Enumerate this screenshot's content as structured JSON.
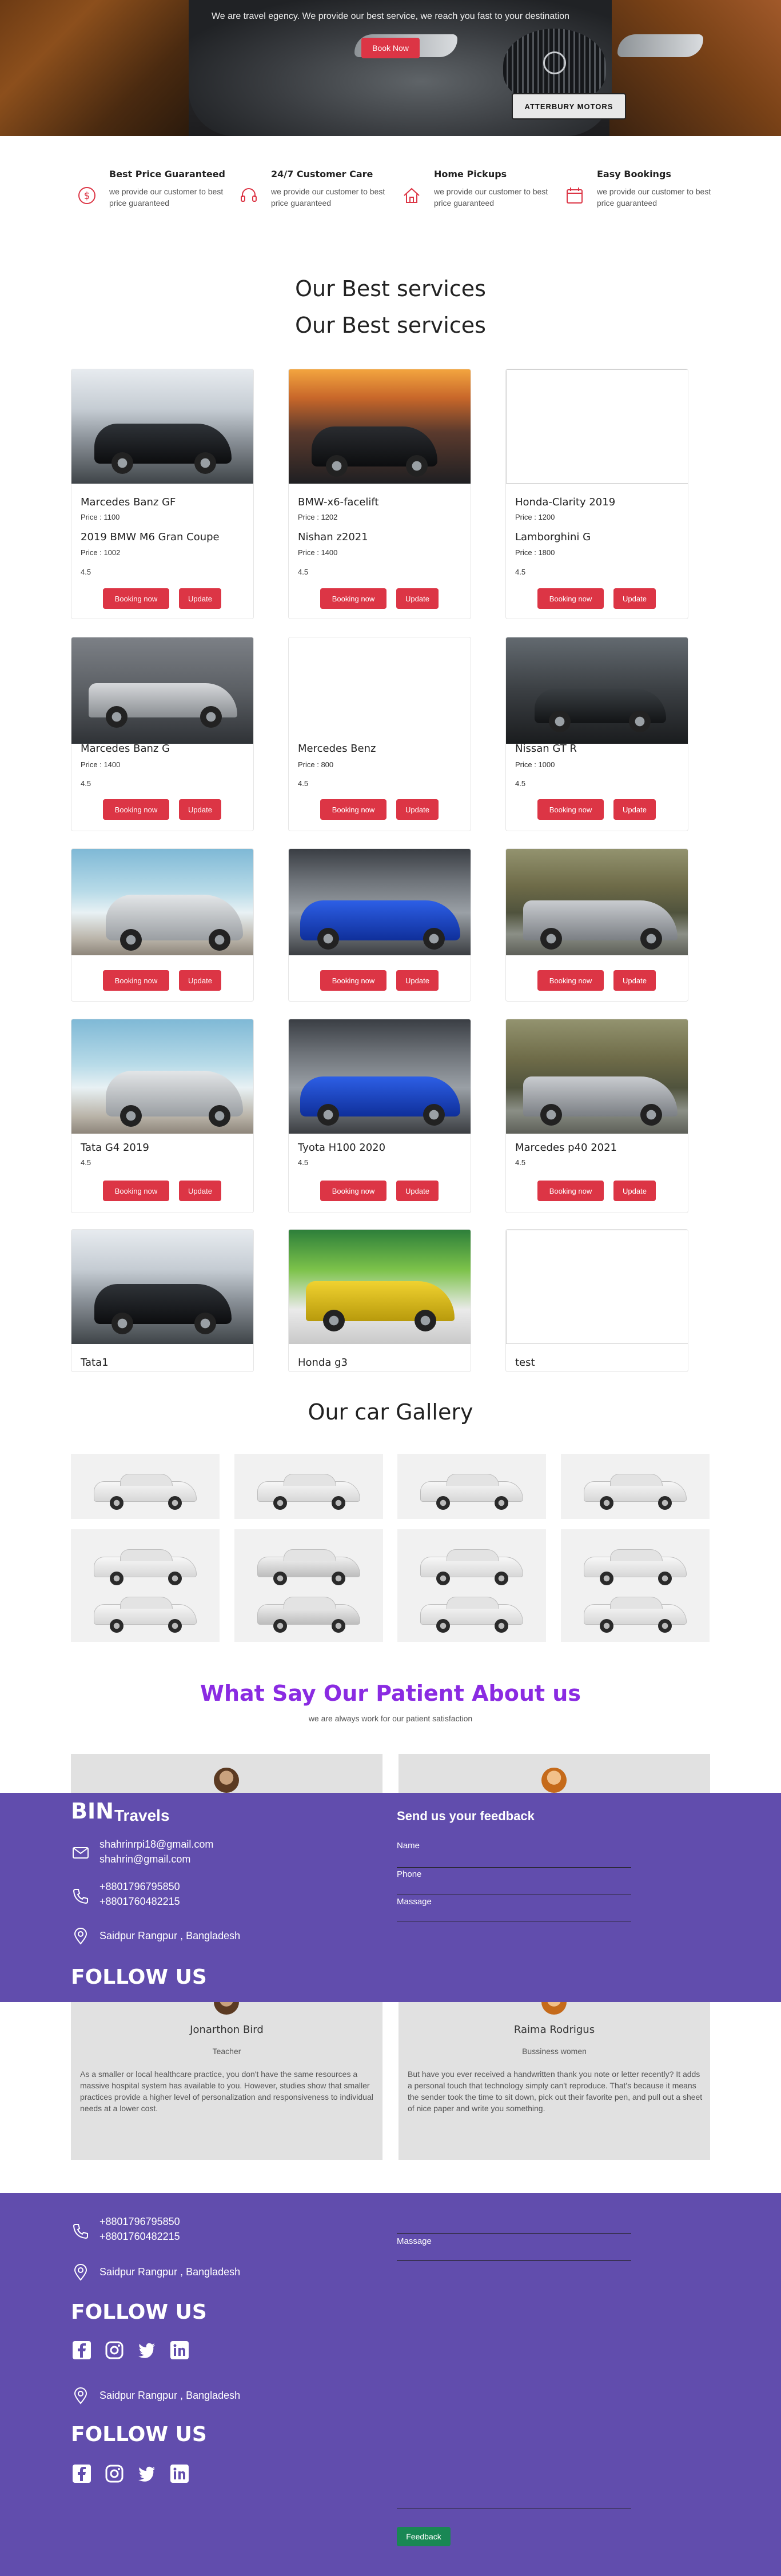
{
  "hero": {
    "tagline": "We are travel egency. We provide our best service, we reach you fast to your destination",
    "book_label": "Book Now",
    "plate_text": "ATTERBURY MOTORS"
  },
  "features": [
    {
      "title": "Best Price Guaranteed",
      "desc": "we provide our customer to best price guaranteed",
      "icon": "dollar-coin-icon"
    },
    {
      "title": "24/7 Customer Care",
      "desc": "we provide our customer to best price guaranteed",
      "icon": "headset-icon"
    },
    {
      "title": "Home Pickups",
      "desc": "we provide our customer to best price guaranteed",
      "icon": "home-icon"
    },
    {
      "title": "Easy Bookings",
      "desc": "we provide our customer to best price guaranteed",
      "icon": "calendar-icon"
    }
  ],
  "services": {
    "title": "Our Best services",
    "title_dup": "Our Best services",
    "book_label": "Booking now",
    "update_label": "Update",
    "row1": [
      {
        "name": "Marcedes Banz GF",
        "price": "Price : 1100",
        "name2": "2019 BMW M6 Gran Coupe",
        "price2": "Price : 1002",
        "rating": "4.5"
      },
      {
        "name": "BMW-x6-facelift",
        "price": "Price : 1202",
        "name2": "Nishan z2021",
        "price2": "Price : 1400",
        "rating": "4.5"
      },
      {
        "name": "Honda-Clarity 2019",
        "price": "Price : 1200",
        "name2": "Lamborghini G",
        "price2": "Price : 1800",
        "rating": "4.5"
      }
    ],
    "row2": [
      {
        "name": "Marcedes Banz G",
        "price": "Price : 1400",
        "rating": "4.5"
      },
      {
        "name": "Mercedes Benz",
        "price": "Price : 800",
        "rating": "4.5"
      },
      {
        "name": "Nissan GT R",
        "price": "Price : 1000",
        "rating": "4.5"
      }
    ],
    "row4": [
      {
        "name": "Tata G4 2019",
        "rating": "4.5"
      },
      {
        "name": "Tyota H100 2020",
        "rating": "4.5"
      },
      {
        "name": "Marcedes p40 2021",
        "rating": "4.5"
      }
    ],
    "row5": [
      {
        "name": "Tata1"
      },
      {
        "name": "Honda g3"
      },
      {
        "name": "test"
      }
    ]
  },
  "gallery": {
    "title": "Our car Gallery"
  },
  "testimonials": {
    "title": "What Say Our Patient About us",
    "subtitle": "we are always work for our patient satisfaction",
    "items": [
      {
        "name": "Jonarthon Bird",
        "role": "Teacher",
        "text": "As a smaller or local healthcare practice, you don't have the same resources a massive hospital system has available to you. However, studies show that smaller practices provide a higher level of personalization and responsiveness to individual needs at a lower cost."
      },
      {
        "name": "Raima Rodrigus",
        "role": "Bussiness women",
        "text": "But have you ever received a handwritten thank you note or letter recently? It adds a personal touch that technology simply can't reproduce. That's because it means the sender took the time to sit down, pick out their favorite pen, and pull out a sheet of nice paper and write you something."
      }
    ]
  },
  "footer": {
    "brand_bold": "BIN",
    "brand_rest": "Travels",
    "email1": "shahrinrpi18@gmail.com",
    "email2": "shahrin@gmail.com",
    "phone1": "+8801796795850",
    "phone2": "+8801760482215",
    "address": "Saidpur Rangpur , Bangladesh",
    "follow": "FOLLOW US",
    "feedback_title": "Send us your feedback",
    "name_label": "Name",
    "phone_label": "Phone",
    "message_label": "Massage",
    "feedback_btn": "Feedback",
    "social": [
      "facebook-icon",
      "instagram-icon",
      "twitter-icon",
      "linkedin-icon"
    ]
  },
  "colors": {
    "accent": "#dc3545",
    "footer": "#614dad",
    "purple_title": "#8a2be2",
    "feedback_btn": "#198754"
  }
}
